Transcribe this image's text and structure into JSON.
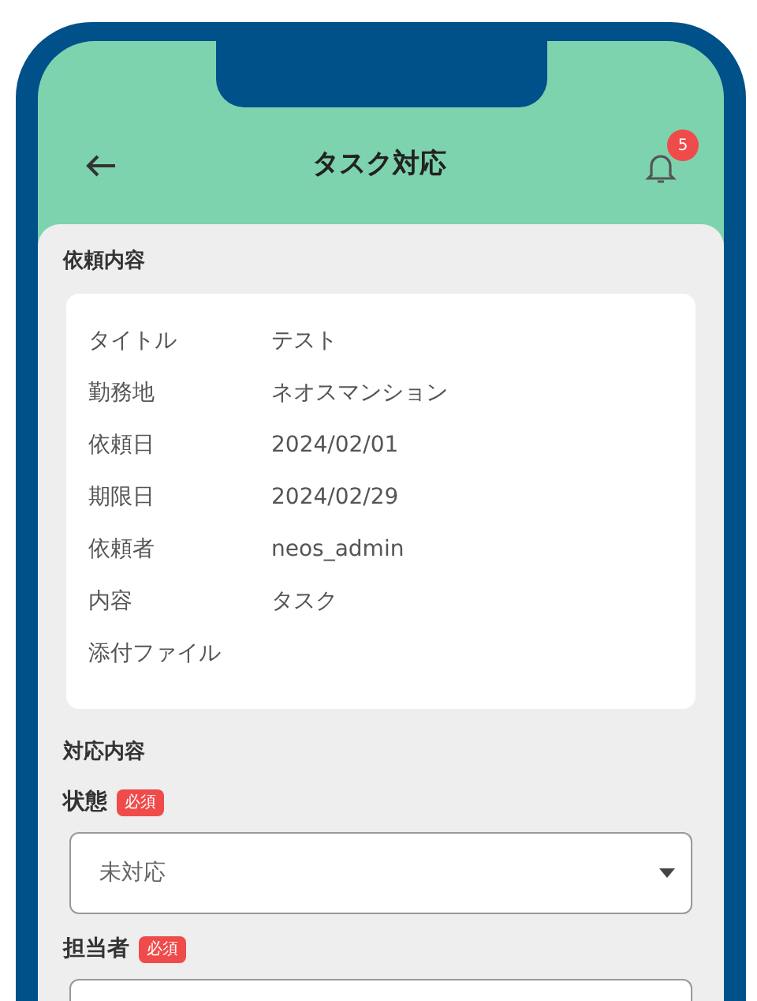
{
  "header": {
    "title": "タスク対応",
    "notification_count": "5"
  },
  "request": {
    "heading": "依頼内容",
    "rows": [
      {
        "label": "タイトル",
        "value": "テスト"
      },
      {
        "label": "勤務地",
        "value": "ネオスマンション"
      },
      {
        "label": "依頼日",
        "value": "2024/02/01"
      },
      {
        "label": "期限日",
        "value": "2024/02/29"
      },
      {
        "label": "依頼者",
        "value": "neos_admin"
      },
      {
        "label": "内容",
        "value": "タスク"
      },
      {
        "label": "添付ファイル"
      }
    ]
  },
  "response": {
    "heading": "対応内容",
    "fields": [
      {
        "label": "状態",
        "required_badge": "必須",
        "value": "未対応"
      },
      {
        "label": "担当者",
        "required_badge": "必須"
      }
    ]
  }
}
